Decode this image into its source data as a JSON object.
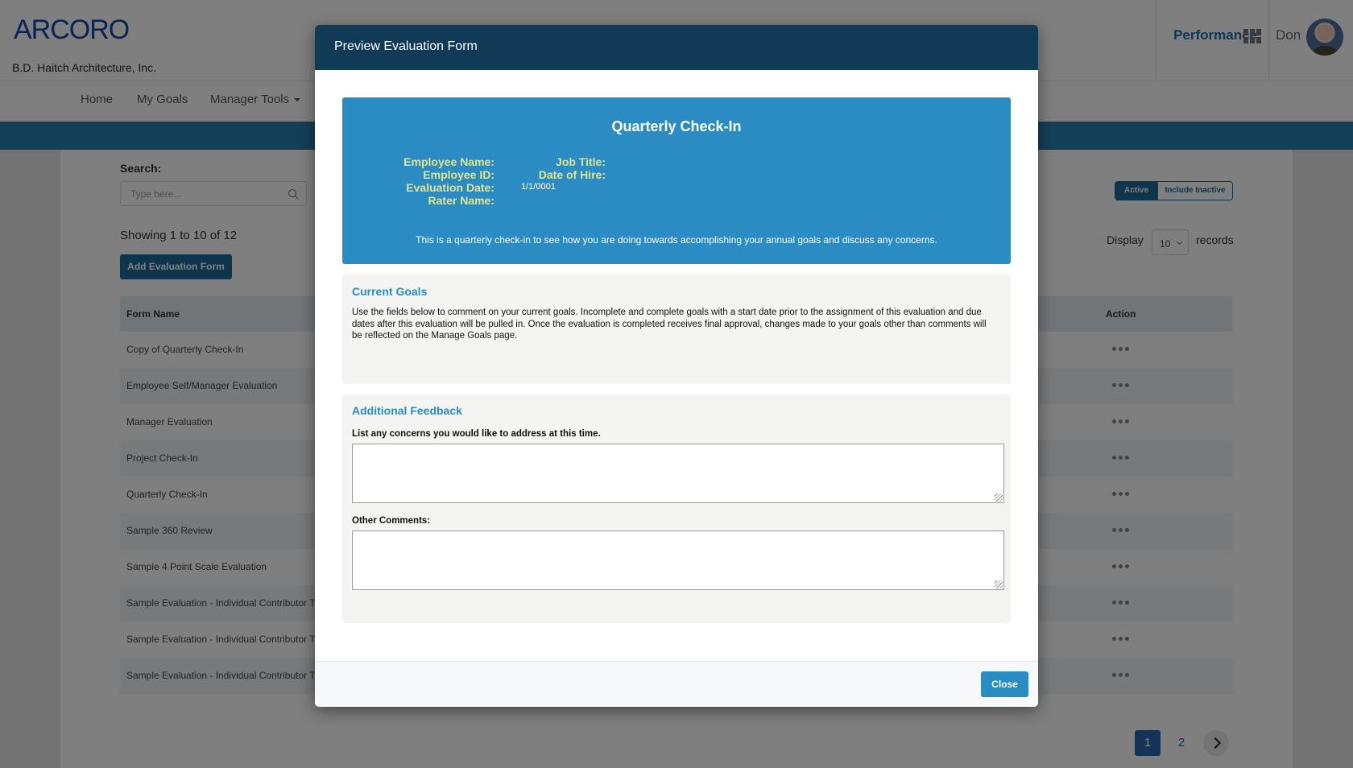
{
  "app": {
    "logo": "ARCORO",
    "company": "B.D. Haitch Architecture, Inc.",
    "module": "Performance",
    "user": "Don",
    "nav": [
      {
        "label": "Home"
      },
      {
        "label": "My Goals"
      },
      {
        "label": "Manager Tools"
      }
    ]
  },
  "list": {
    "search_label": "Search:",
    "search_placeholder": "Type here...",
    "search_value": "",
    "showing": "Showing 1 to 10 of 12",
    "add_button": "Add Evaluation Form",
    "filter": {
      "active": "Active",
      "inactive": "Include Inactive",
      "selected": "Active"
    },
    "display_label": "Display",
    "display_value": "10",
    "records_label": "records",
    "columns": {
      "name": "Form Name",
      "action": "Action"
    },
    "rows": [
      {
        "name": "Copy of Quarterly Check-In"
      },
      {
        "name": "Employee Self/Manager Evaluation"
      },
      {
        "name": "Manager Evaluation"
      },
      {
        "name": "Project Check-In"
      },
      {
        "name": "Quarterly Check-In"
      },
      {
        "name": "Sample 360 Review"
      },
      {
        "name": "Sample 4 Point Scale Evaluation"
      },
      {
        "name": "Sample Evaluation - Individual Contributor Th"
      },
      {
        "name": "Sample Evaluation - Individual Contributor Th"
      },
      {
        "name": "Sample Evaluation - Individual Contributor Th"
      }
    ],
    "pagination": {
      "current": "1",
      "pages": [
        "1",
        "2"
      ]
    }
  },
  "modal": {
    "title": "Preview Evaluation Form",
    "form": {
      "name": "Quarterly Check-In",
      "labels": {
        "employee_name": "Employee Name:",
        "employee_id": "Employee ID:",
        "evaluation_date": "Evaluation Date:",
        "rater_name": "Rater Name:",
        "job_title": "Job Title:",
        "date_of_hire": "Date of Hire:"
      },
      "values": {
        "evaluation_date": "1/1/0001"
      },
      "description": "This is a quarterly check-in to see how you are doing towards accomplishing your annual goals and discuss any concerns."
    },
    "sections": {
      "current_goals": {
        "title": "Current Goals",
        "text": "Use the fields below to comment on your current goals. Incomplete and complete goals with a start date prior to the assignment of this evaluation and due dates after this evaluation will be pulled in. Once the evaluation is completed receives final approval, changes made to your goals other than comments will be reflected on the Manage Goals page."
      },
      "additional_feedback": {
        "title": "Additional Feedback",
        "q1_label": "List any concerns you would like to address at this time.",
        "q1_value": "",
        "q2_label": "Other Comments:",
        "q2_value": ""
      }
    },
    "close_button": "Close"
  },
  "colors": {
    "brand_blue": "#1645a8",
    "primary": "#2a8cc3",
    "header_dark": "#103a55",
    "label_yellow": "#e6e389"
  }
}
